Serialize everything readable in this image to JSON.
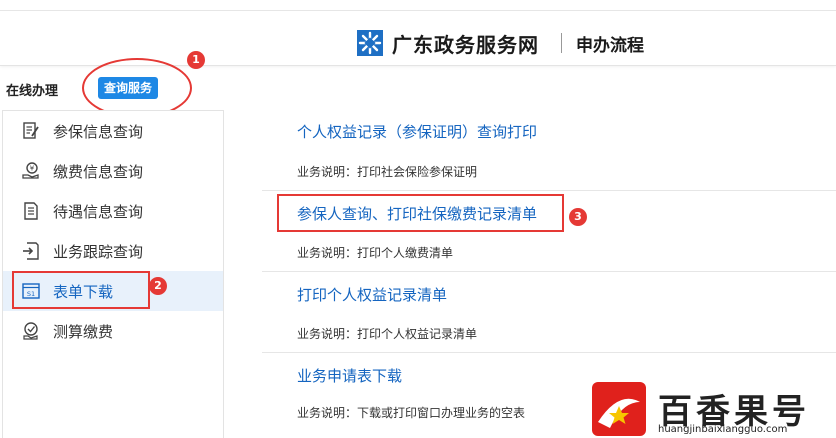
{
  "header": {
    "site_name": "广东政务服务网",
    "page_name": "申办流程"
  },
  "tabs": {
    "online": "在线办理",
    "query": "查询服务"
  },
  "colors": {
    "accent": "#1e88e5",
    "link": "#1565c0",
    "highlight": "#e53935",
    "active_bg": "#e8f1fb"
  },
  "annotations": [
    "1",
    "2",
    "3"
  ],
  "sidebar": {
    "items": [
      {
        "label": "参保信息查询",
        "icon": "document-edit-icon"
      },
      {
        "label": "缴费信息查询",
        "icon": "coin-hand-icon"
      },
      {
        "label": "待遇信息查询",
        "icon": "document-list-icon"
      },
      {
        "label": "业务跟踪查询",
        "icon": "document-arrow-icon"
      },
      {
        "label": "表单下载",
        "icon": "form-download-icon"
      },
      {
        "label": "测算缴费",
        "icon": "calculator-coin-icon"
      }
    ],
    "active_index": 4
  },
  "services": [
    {
      "title": "个人权益记录（参保证明）查询打印",
      "desc": "业务说明：打印社会保险参保证明"
    },
    {
      "title": "参保人查询、打印社保缴费记录清单",
      "desc": "业务说明：打印个人缴费清单"
    },
    {
      "title": "打印个人权益记录清单",
      "desc": "业务说明：打印个人权益记录清单"
    },
    {
      "title": "业务申请表下载",
      "desc": "业务说明：下载或打印窗口办理业务的空表"
    }
  ],
  "watermark": {
    "name": "百香果号",
    "url": "huangjinbaixiangguo.com"
  }
}
